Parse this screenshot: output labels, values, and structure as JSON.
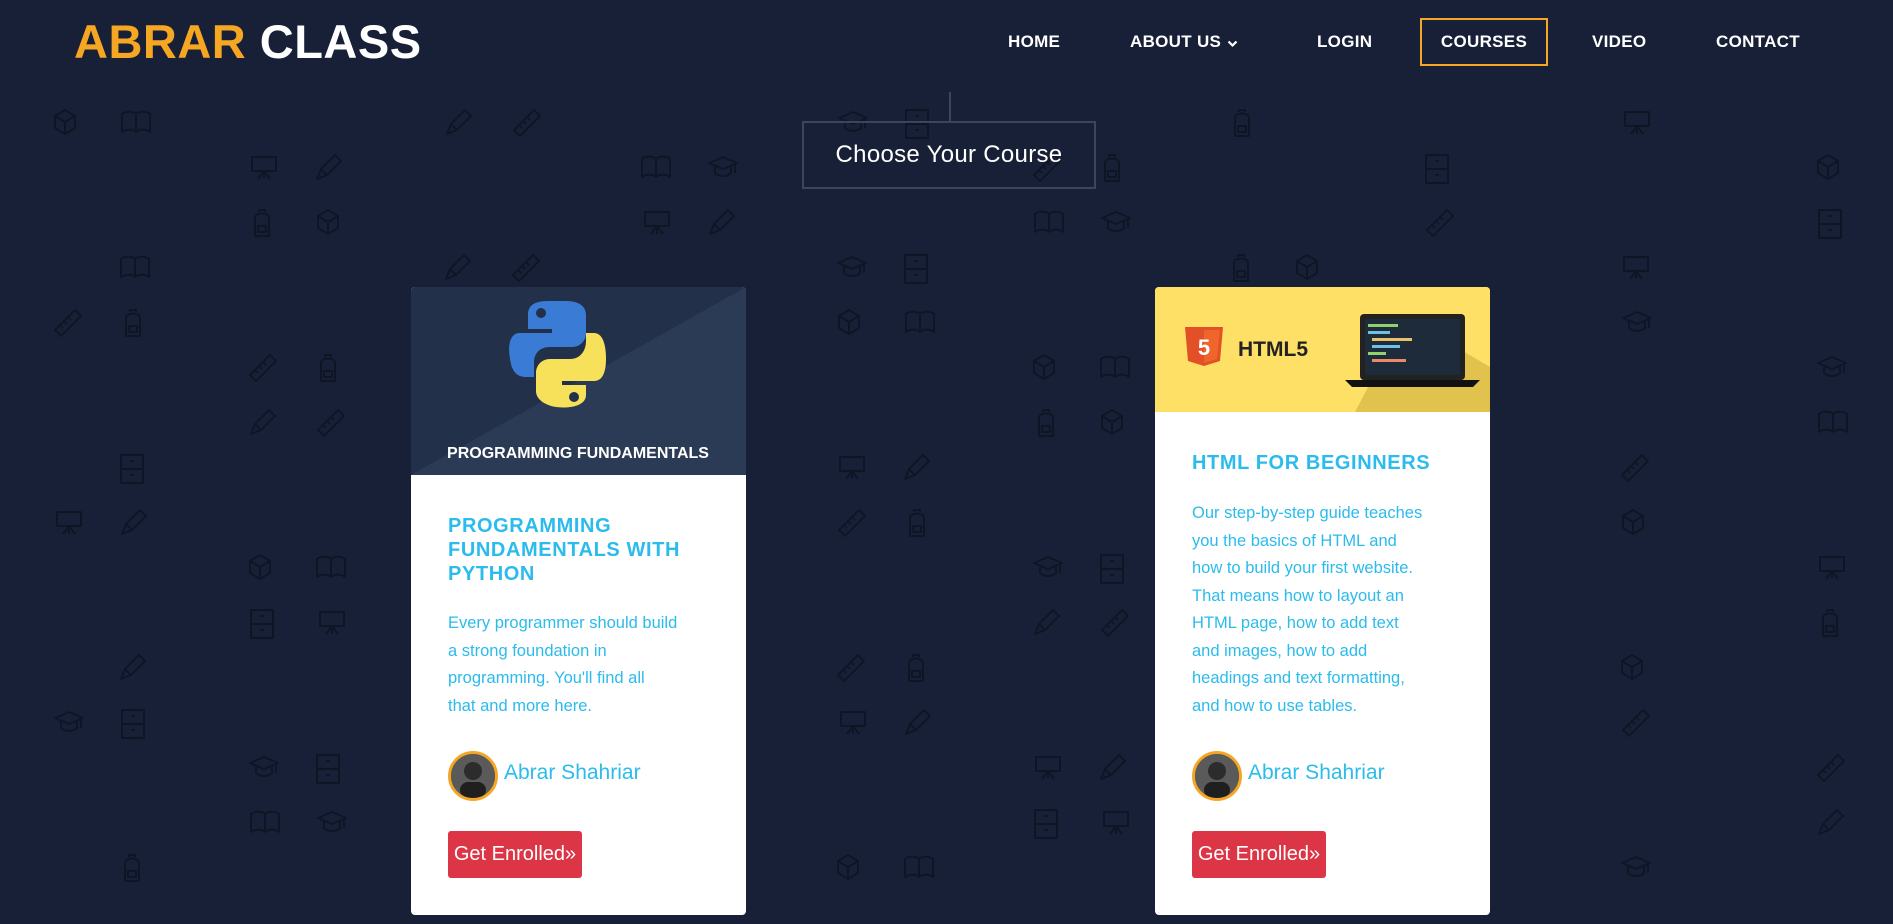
{
  "brand": {
    "part1": "ABRAR",
    "part2": "CLASS"
  },
  "nav": {
    "home": "HOME",
    "about": "ABOUT US",
    "login": "LOGIN",
    "courses": "COURSES",
    "video": "VIDEO",
    "contact": "CONTACT",
    "active": "COURSES"
  },
  "section": {
    "title": "Choose Your Course"
  },
  "courses": [
    {
      "banner_text": "PROGRAMMING FUNDAMENTALS",
      "title_lines": [
        "PROGRAMMING",
        "FUNDAMENTALS WITH",
        "PYTHON"
      ],
      "desc_lines": [
        "Every programmer should build",
        "a strong foundation in",
        "programming. You'll find all",
        "that and more here."
      ],
      "author": "Abrar Shahriar",
      "button": "Get Enrolled»"
    },
    {
      "banner_text": "HTML5",
      "title_lines": [
        "HTML FOR BEGINNERS"
      ],
      "desc_lines": [
        "Our step-by-step guide teaches",
        "you the basics of HTML and",
        "how to build your first website.",
        "That means how to layout an",
        "HTML page, how to add text",
        "and images, how to add",
        "headings and text formatting,",
        "and how to use tables."
      ],
      "author": "Abrar Shahriar",
      "button": "Get Enrolled»"
    }
  ],
  "colors": {
    "background": "#172036",
    "brand_accent": "#f5a623",
    "link_blue": "#2bbbec",
    "button_red": "#dc3545",
    "html_banner_yellow": "#ffe066"
  },
  "icons": [
    "cube-icon",
    "pencil-icon",
    "graduation-cap-icon",
    "backpack-icon",
    "easel-icon",
    "book-icon",
    "ruler-icon",
    "cabinet-icon",
    "python-logo-icon",
    "html5-logo-icon",
    "laptop-icon"
  ]
}
